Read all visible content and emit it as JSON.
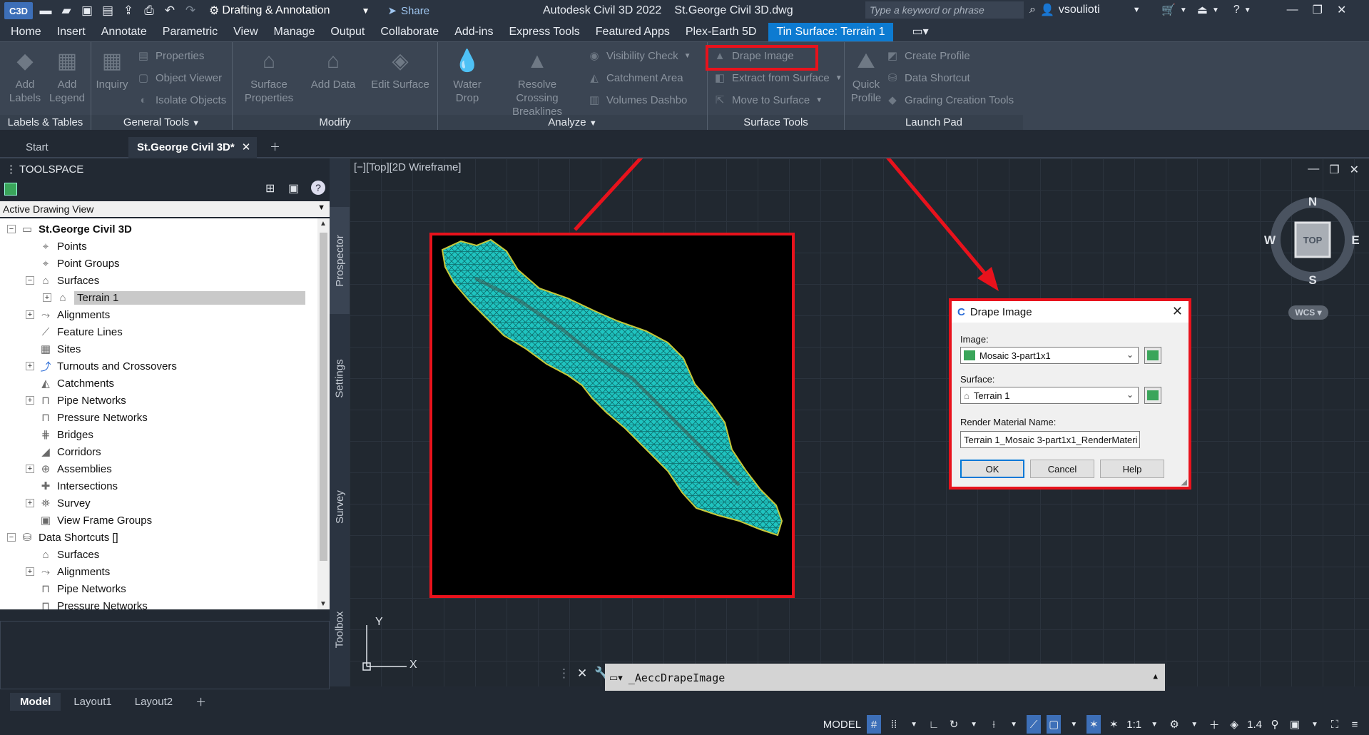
{
  "titlebar": {
    "logo": "C3D",
    "workspace": "Drafting & Annotation",
    "share": "Share",
    "app": "Autodesk Civil 3D 2022",
    "file": "St.George Civil 3D.dwg",
    "search_placeholder": "Type a keyword or phrase",
    "user": "vsoulioti"
  },
  "menubar": {
    "tabs": [
      "Home",
      "Insert",
      "Annotate",
      "Parametric",
      "View",
      "Manage",
      "Output",
      "Collaborate",
      "Add-ins",
      "Express Tools",
      "Featured Apps",
      "Plex-Earth 5D"
    ],
    "context_tab": "Tin Surface: Terrain 1"
  },
  "ribbon": {
    "labels_tables": {
      "title": "Labels & Tables",
      "add_labels": "Add Labels",
      "add_legend": "Add Legend"
    },
    "general_tools": {
      "title": "General Tools",
      "inquiry": "Inquiry",
      "properties": "Properties",
      "object_viewer": "Object Viewer",
      "isolate_objects": "Isolate Objects"
    },
    "modify": {
      "title": "Modify",
      "surface_properties": "Surface Properties",
      "add_data": "Add Data",
      "edit_surface": "Edit Surface"
    },
    "analyze": {
      "title": "Analyze",
      "water_drop": "Water Drop",
      "resolve_crossing": "Resolve Crossing Breaklines",
      "visibility_check": "Visibility Check",
      "catchment_area": "Catchment Area",
      "volumes_dashboard": "Volumes Dashbo"
    },
    "surface_tools": {
      "title": "Surface Tools",
      "drape_image": "Drape Image",
      "extract_from_surface": "Extract from Surface",
      "move_to_surface": "Move to Surface"
    },
    "launch_pad": {
      "title": "Launch Pad",
      "quick_profile": "Quick Profile",
      "create_profile": "Create Profile",
      "data_shortcut": "Data Shortcut",
      "grading_creation": "Grading Creation Tools"
    }
  },
  "doctabs": {
    "start": "Start",
    "drawing": "St.George Civil 3D*"
  },
  "toolspace": {
    "title": "TOOLSPACE",
    "view": "Active Drawing View",
    "root": "St.George Civil 3D",
    "items": [
      "Points",
      "Point Groups",
      "Surfaces",
      "Terrain 1",
      "Alignments",
      "Feature Lines",
      "Sites",
      "Turnouts and Crossovers",
      "Catchments",
      "Pipe Networks",
      "Pressure Networks",
      "Bridges",
      "Corridors",
      "Assemblies",
      "Intersections",
      "Survey",
      "View Frame Groups"
    ],
    "data_shortcuts": "Data Shortcuts []",
    "ds_items": [
      "Surfaces",
      "Alignments",
      "Pipe Networks",
      "Pressure Networks"
    ],
    "side_tabs": [
      "Prospector",
      "Settings",
      "Survey",
      "Toolbox"
    ]
  },
  "viewport": {
    "label": "[−][Top][2D Wireframe]",
    "compass": {
      "n": "N",
      "s": "S",
      "e": "E",
      "w": "W",
      "top": "TOP",
      "wcs": "WCS"
    },
    "ucs": {
      "x": "X",
      "y": "Y"
    }
  },
  "dialog": {
    "title": "Drape Image",
    "image_label": "Image:",
    "image_value": "Mosaic 3-part1x1",
    "surface_label": "Surface:",
    "surface_value": "Terrain 1",
    "material_label": "Render Material Name:",
    "material_value": "Terrain 1_Mosaic 3-part1x1_RenderMateri",
    "ok": "OK",
    "cancel": "Cancel",
    "help": "Help"
  },
  "command": {
    "text": "_AeccDrapeImage"
  },
  "layouts": [
    "Model",
    "Layout1",
    "Layout2"
  ],
  "status": {
    "model": "MODEL",
    "scale": "1:1",
    "zoom": "1.4"
  },
  "colors": {
    "accent": "#0d7bd1",
    "highlight": "#e8121c",
    "mesh": "#2fd6d0"
  }
}
